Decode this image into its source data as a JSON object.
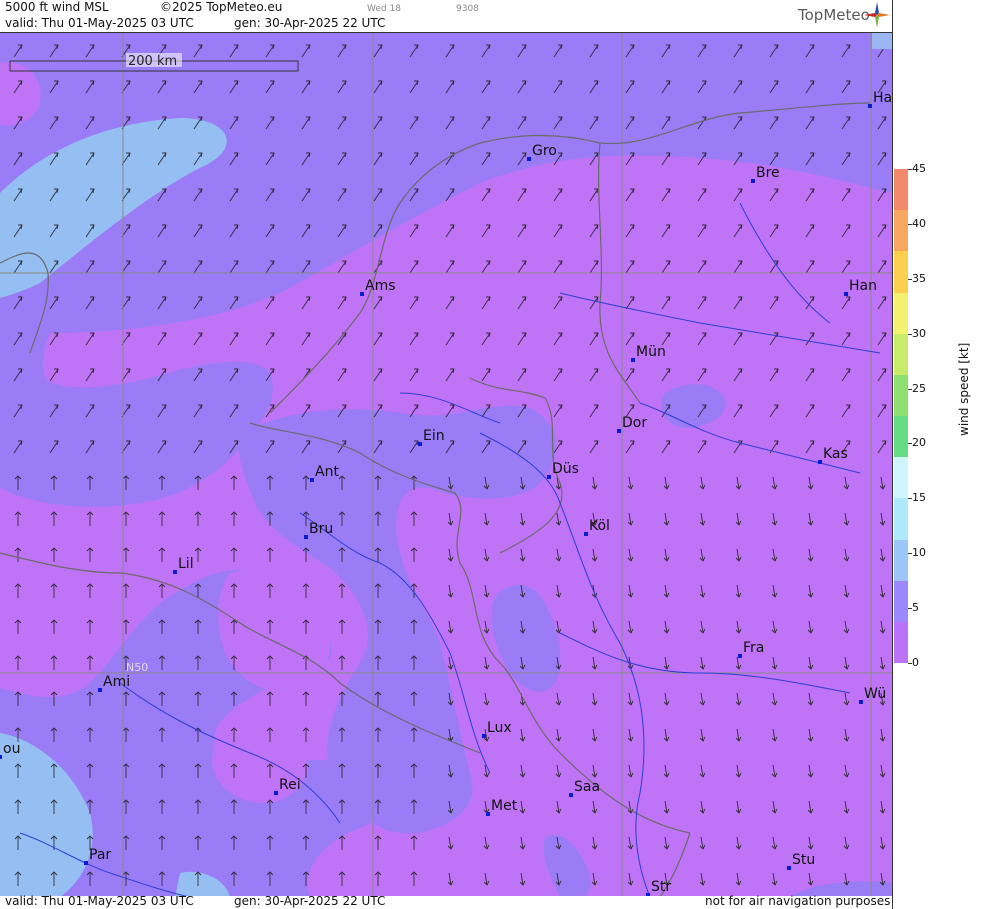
{
  "header": {
    "title": "5000 ft wind MSL",
    "copyright": "©2025 TopMeteo.eu",
    "run_label": "Wed 18",
    "code": "9308",
    "valid": "valid:  Thu  01-May-2025  03 UTC",
    "gen": "gen: 30-Apr-2025 22 UTC",
    "logo": "TopMeteo"
  },
  "footer": {
    "valid": "valid:  Thu  01-May-2025  03 UTC",
    "gen": "gen: 30-Apr-2025 22 UTC",
    "disclaimer": "not for air navigation purposes"
  },
  "map": {
    "scale_label": "200 km",
    "lat_label": "N50",
    "cities": [
      {
        "name": "Gro"
      },
      {
        "name": "Bre"
      },
      {
        "name": "Ha"
      },
      {
        "name": "Han"
      },
      {
        "name": "Ams"
      },
      {
        "name": "Mün"
      },
      {
        "name": "Dor"
      },
      {
        "name": "Ein"
      },
      {
        "name": "Kas"
      },
      {
        "name": "Ant"
      },
      {
        "name": "Düs"
      },
      {
        "name": "Bru"
      },
      {
        "name": "Köl"
      },
      {
        "name": "Lil"
      },
      {
        "name": "Fra"
      },
      {
        "name": "Ami"
      },
      {
        "name": "Wü"
      },
      {
        "name": "Lux"
      },
      {
        "name": "ou"
      },
      {
        "name": "Rei"
      },
      {
        "name": "Saa"
      },
      {
        "name": "Met"
      },
      {
        "name": "Par"
      },
      {
        "name": "Stu"
      },
      {
        "name": "Str"
      }
    ]
  },
  "legend": {
    "title": "wind  speed  [kt]",
    "ticks": [
      "45",
      "40",
      "35",
      "30",
      "25",
      "20",
      "15",
      "10",
      "5",
      "0"
    ],
    "colors": [
      "#f08a6a",
      "#f6a860",
      "#fbd050",
      "#f4f070",
      "#c8ec6a",
      "#8fe070",
      "#64dc84",
      "#cff6ff",
      "#aee8fa",
      "#9bc6f6",
      "#9b88ff",
      "#bb72f8"
    ]
  },
  "colors": {
    "band_0_5": "#bf74f7",
    "band_5_10": "#9a7cf7",
    "band_10_15": "#95bef2",
    "arrow": "#222222",
    "river": "#2c3fd0",
    "border": "#666666",
    "grid": "#8a8a8a"
  }
}
